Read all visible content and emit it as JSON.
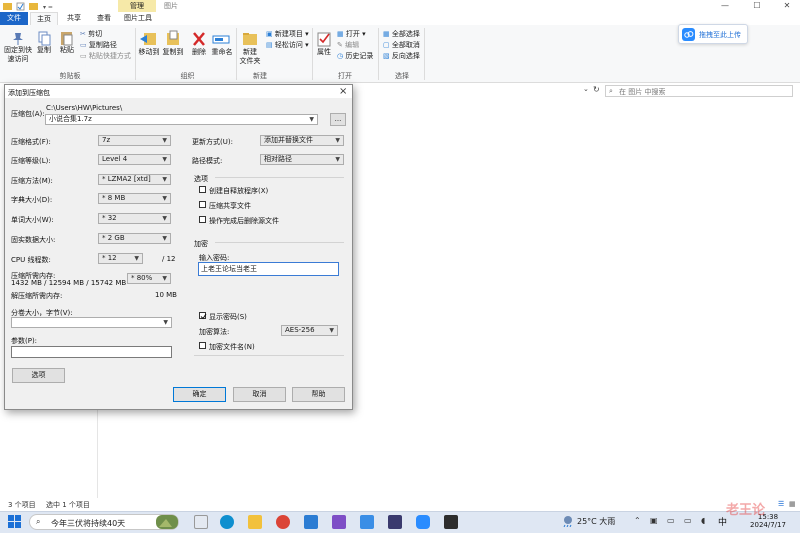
{
  "window": {
    "context_tab": "管理",
    "title": "图片",
    "minimize": "—",
    "maximize": "☐",
    "close": "✕"
  },
  "ribbon": {
    "tabs": [
      "文件",
      "主页",
      "共享",
      "查看",
      "图片工具"
    ],
    "clipboard": {
      "pin": "固定到快\n速访问",
      "copy": "复制",
      "paste": "粘贴",
      "cut": "剪切",
      "copy_path": "复制路径",
      "paste_shortcut": "粘贴快捷方式",
      "label": "剪贴板"
    },
    "organize": {
      "move_to": "移动到",
      "copy_to": "复制到",
      "delete": "删除",
      "rename": "重命名",
      "label": "组织"
    },
    "new": {
      "new_folder": "新建\n文件夹",
      "new_item": "新建项目 ▾",
      "easy_access": "轻松访问 ▾",
      "label": "新建"
    },
    "open": {
      "properties": "属性",
      "open": "打开 ▾",
      "edit": "编辑",
      "history": "历史记录",
      "label": "打开"
    },
    "select": {
      "select_all": "全部选择",
      "select_none": "全部取消",
      "invert": "反向选择",
      "label": "选择"
    }
  },
  "upload_badge": "拖拽至此上传",
  "search_placeholder": "在 图片 中搜索",
  "status": {
    "items": "3 个项目",
    "selected": "选中 1 个项目"
  },
  "dialog": {
    "title": "添加到压缩包",
    "close": "×",
    "archive_label": "压缩包(A):",
    "archive_dir": "C:\\Users\\HW\\Pictures\\",
    "archive_name": "小说合集1.7z",
    "browse": "...",
    "format_label": "压缩格式(F):",
    "format_value": "7z",
    "level_label": "压缩等级(L):",
    "level_value": "Level 4",
    "method_label": "压缩方法(M):",
    "method_value": "* LZMA2 [xtd]",
    "dict_label": "字典大小(D):",
    "dict_value": "* 8 MB",
    "word_label": "单词大小(W):",
    "word_value": "* 32",
    "solid_label": "固实数据大小:",
    "solid_value": "* 2 GB",
    "threads_label": "CPU 线程数:",
    "threads_value": "* 12",
    "threads_max": "/ 12",
    "mem_label": "压缩所需内存:",
    "mem_detail": "1432 MB / 12594 MB / 15742 MB",
    "mem_percent": "* 80%",
    "decomp_label": "解压缩所需内存:",
    "decomp_value": "10 MB",
    "split_label": "分卷大小，字节(V):",
    "params_label": "参数(P):",
    "options_btn": "选项",
    "update_label": "更新方式(U):",
    "update_value": "添加并替换文件",
    "path_label": "路径模式:",
    "path_value": "相对路径",
    "options_group": "选项",
    "opt_sfx": "创建自释放程序(X)",
    "opt_shared": "压缩共享文件",
    "opt_delete": "操作完成后删除源文件",
    "encrypt_group": "加密",
    "password_label": "输入密码:",
    "password_value": "上老王论坛当老王",
    "show_password": "显示密码(S)",
    "enc_method_label": "加密算法:",
    "enc_method_value": "AES-256",
    "encrypt_names": "加密文件名(N)",
    "ok": "确定",
    "cancel": "取消",
    "help": "帮助"
  },
  "taskbar": {
    "search_text": "今年三伏将持续40天",
    "weather": "25°C 大雨",
    "ime": "中",
    "time": "15:38",
    "date": "2024/7/17"
  },
  "watermark": "老王论"
}
